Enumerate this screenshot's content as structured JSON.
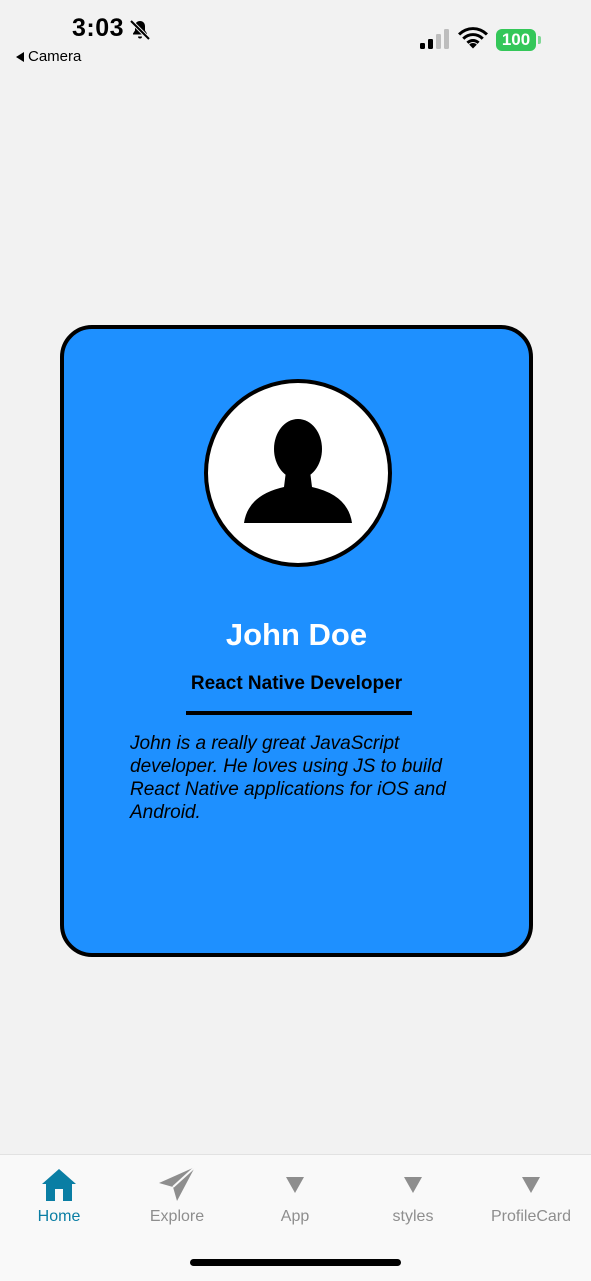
{
  "status_bar": {
    "time": "3:03",
    "back_label": "Camera",
    "battery": "100",
    "battery_color": "#34c759",
    "icons": [
      "bell-slash-icon",
      "signal-icon",
      "wifi-icon",
      "battery-icon"
    ]
  },
  "profile_card": {
    "name": "John Doe",
    "role": "React Native Developer",
    "bio": "John is a really great JavaScript developer. He loves using JS to build React Native applications for iOS and Android.",
    "avatar_icon": "person-silhouette-icon",
    "background_color": "#1e90ff"
  },
  "tab_bar": {
    "active_color": "#0a7ea4",
    "inactive_color": "#8e8e8e",
    "tabs": [
      {
        "label": "Home",
        "icon": "home-icon",
        "active": true
      },
      {
        "label": "Explore",
        "icon": "paper-plane-icon",
        "active": false
      },
      {
        "label": "App",
        "icon": "caret-down-icon",
        "active": false
      },
      {
        "label": "styles",
        "icon": "caret-down-icon",
        "active": false
      },
      {
        "label": "ProfileCard",
        "icon": "caret-down-icon",
        "active": false
      }
    ]
  }
}
